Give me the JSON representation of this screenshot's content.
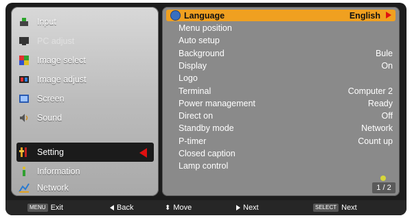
{
  "left_menu": {
    "items": [
      {
        "label": "Input",
        "icon": "input-icon",
        "disabled": false
      },
      {
        "label": "PC adjust",
        "icon": "pc-adjust-icon",
        "disabled": true
      },
      {
        "label": "Image select",
        "icon": "image-select-icon",
        "disabled": false
      },
      {
        "label": "Image adjust",
        "icon": "image-adjust-icon",
        "disabled": false
      },
      {
        "label": "Screen",
        "icon": "screen-icon",
        "disabled": false
      },
      {
        "label": "Sound",
        "icon": "sound-icon",
        "disabled": false
      },
      {
        "label": "Setting",
        "icon": "setting-icon",
        "disabled": false,
        "active": true
      },
      {
        "label": "Information",
        "icon": "information-icon",
        "disabled": false
      },
      {
        "label": "Network",
        "icon": "network-icon",
        "disabled": false
      }
    ]
  },
  "settings": {
    "rows": [
      {
        "name": "Language",
        "value": "English",
        "highlight": true
      },
      {
        "name": "Menu position",
        "value": ""
      },
      {
        "name": "Auto setup",
        "value": ""
      },
      {
        "name": "Background",
        "value": "Bule"
      },
      {
        "name": "Display",
        "value": "On"
      },
      {
        "name": "Logo",
        "value": ""
      },
      {
        "name": "Terminal",
        "value": "Computer 2"
      },
      {
        "name": "Power management",
        "value": "Ready"
      },
      {
        "name": "Direct on",
        "value": "Off"
      },
      {
        "name": "Standby mode",
        "value": "Network"
      },
      {
        "name": "P-timer",
        "value": "Count up"
      },
      {
        "name": "Closed caption",
        "value": ""
      },
      {
        "name": "Lamp control",
        "value": ""
      }
    ],
    "page_indicator": "1 / 2"
  },
  "bottom_bar": {
    "exit_key": "MENU",
    "exit_label": "Exit",
    "back_label": "Back",
    "move_label": "Move",
    "next_label": "Next",
    "select_key": "SELECT",
    "select_label": "Next"
  },
  "colors": {
    "highlight": "#f0a020",
    "selector_arrow": "#e01010"
  }
}
